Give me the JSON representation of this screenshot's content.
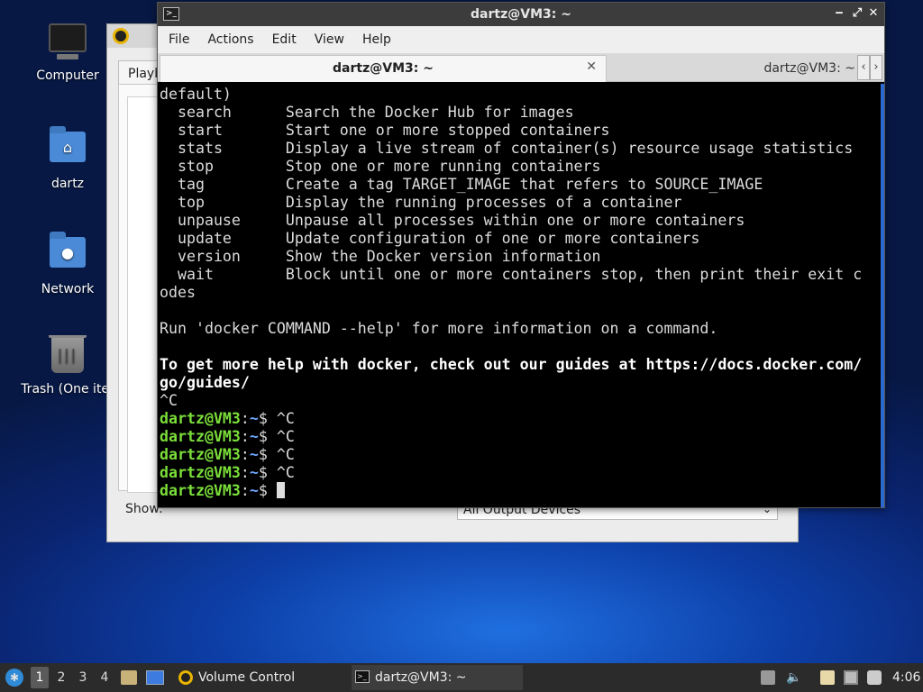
{
  "desktop": {
    "icons": [
      {
        "label": "Computer",
        "icon": "computer-icon"
      },
      {
        "label": "dartz",
        "icon": "home-folder-icon"
      },
      {
        "label": "Network",
        "icon": "network-folder-icon"
      },
      {
        "label": "Trash (One iter",
        "icon": "trash-icon"
      }
    ]
  },
  "volume_window": {
    "tab_label": "Playb",
    "show_label": "Show:",
    "show_value": "All Output Devices"
  },
  "terminal": {
    "title": "dartz@VM3: ~",
    "menu": [
      "File",
      "Actions",
      "Edit",
      "View",
      "Help"
    ],
    "tabs": [
      {
        "label": "dartz@VM3: ~",
        "active": true
      },
      {
        "label": "dartz@VM3: ~",
        "active": false
      }
    ],
    "output_lines": [
      "default)",
      "  search      Search the Docker Hub for images",
      "  start       Start one or more stopped containers",
      "  stats       Display a live stream of container(s) resource usage statistics",
      "  stop        Stop one or more running containers",
      "  tag         Create a tag TARGET_IMAGE that refers to SOURCE_IMAGE",
      "  top         Display the running processes of a container",
      "  unpause     Unpause all processes within one or more containers",
      "  update      Update configuration of one or more containers",
      "  version     Show the Docker version information",
      "  wait        Block until one or more containers stop, then print their exit c",
      "odes",
      "",
      "Run 'docker COMMAND --help' for more information on a command.",
      ""
    ],
    "help_lines": [
      "To get more help with docker, check out our guides at https://docs.docker.com/",
      "go/guides/"
    ],
    "interrupt_line": "^C",
    "prompt_user": "dartz@VM3",
    "prompt_sep": ":",
    "prompt_path": "~",
    "prompt_symbol": "$ ",
    "prompt_commands": [
      "^C",
      "^C",
      "^C",
      "^C",
      ""
    ]
  },
  "taskbar": {
    "workspaces": [
      "1",
      "2",
      "3",
      "4"
    ],
    "active_workspace": "1",
    "tasks": [
      {
        "label": "Volume Control",
        "icon": "volume-control-icon"
      },
      {
        "label": "dartz@VM3: ~",
        "icon": "terminal-icon"
      }
    ],
    "clock": "4:06"
  }
}
